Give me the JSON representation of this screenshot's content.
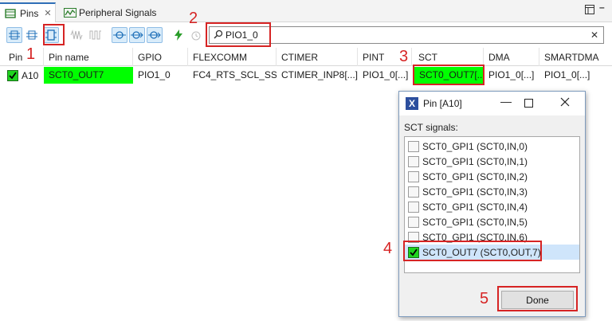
{
  "tabs": [
    {
      "label": "Pins",
      "close": "✕"
    },
    {
      "label": "Peripheral Signals"
    }
  ],
  "search": {
    "value": "PIO1_0",
    "clear": "✕"
  },
  "table": {
    "columns": [
      "Pin",
      "Pin name",
      "GPIO",
      "FLEXCOMM",
      "CTIMER",
      "PINT",
      "SCT",
      "DMA",
      "SMARTDMA"
    ],
    "row": {
      "pin": "A10",
      "pin_name": "SCT0_OUT7",
      "gpio": "PIO1_0",
      "flexcomm": "FC4_RTS_SCL_SS...",
      "ctimer": "CTIMER_INP8[...]",
      "pint": "PIO1_0[...]",
      "sct": "SCT0_OUT7[...]",
      "dma": "PIO1_0[...]",
      "smartdma": "PIO1_0[...]"
    }
  },
  "callouts": [
    "1",
    "2",
    "3",
    "4",
    "5"
  ],
  "dialog": {
    "title": "Pin [A10]",
    "title_icon": "X",
    "label": "SCT signals:",
    "items": [
      {
        "label": "SCT0_GPI1 (SCT0,IN,0)",
        "checked": false
      },
      {
        "label": "SCT0_GPI1 (SCT0,IN,1)",
        "checked": false
      },
      {
        "label": "SCT0_GPI1 (SCT0,IN,2)",
        "checked": false
      },
      {
        "label": "SCT0_GPI1 (SCT0,IN,3)",
        "checked": false
      },
      {
        "label": "SCT0_GPI1 (SCT0,IN,4)",
        "checked": false
      },
      {
        "label": "SCT0_GPI1 (SCT0,IN,5)",
        "checked": false
      },
      {
        "label": "SCT0_GPI1 (SCT0,IN,6)",
        "checked": false
      },
      {
        "label": "SCT0_OUT7 (SCT0,OUT,7)",
        "checked": true
      }
    ],
    "done_label": "Done"
  },
  "colors": {
    "highlight_green": "#00ff00",
    "callout_red": "#d62424",
    "selection_blue": "#cfe5fb"
  }
}
